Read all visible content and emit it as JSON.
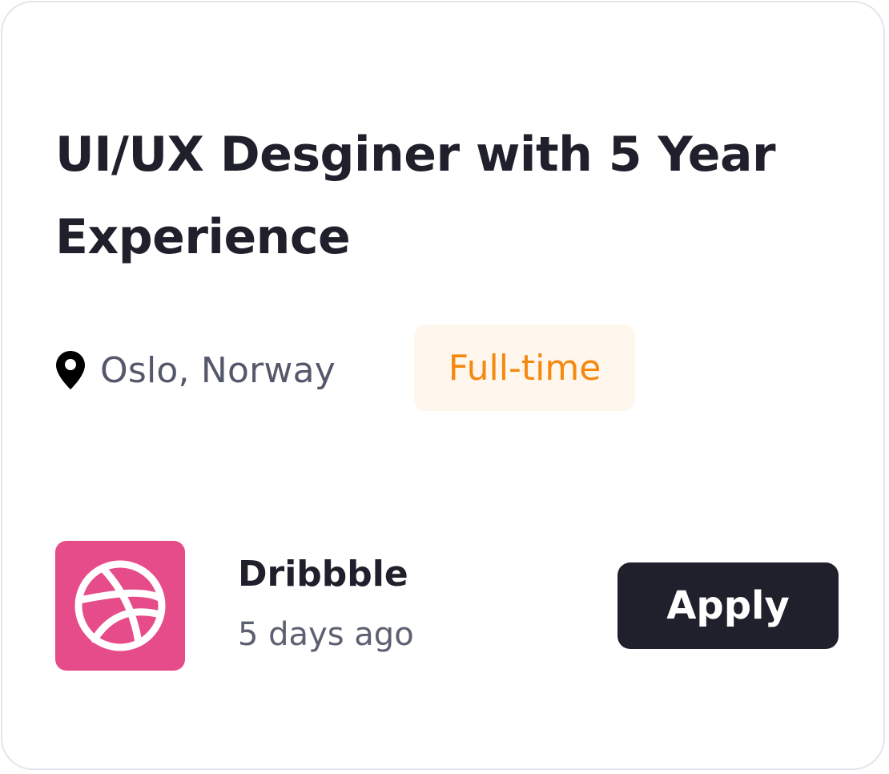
{
  "job": {
    "title": "UI/UX Desginer with 5 Year Experience",
    "location": "Oslo, Norway",
    "location_icon": "map-pin-icon",
    "employment_type": "Full-time"
  },
  "company": {
    "name": "Dribbble",
    "logo_icon": "dribbble-icon",
    "posted": "5 days ago"
  },
  "actions": {
    "apply_label": "Apply"
  },
  "colors": {
    "title_text": "#20202c",
    "muted_text": "#54586a",
    "badge_background": "#fff6ee",
    "badge_text": "#f5890f",
    "logo_background": "#e64c8a",
    "button_background": "#20202c",
    "button_text": "#ffffff",
    "card_border": "#e4e4ec"
  }
}
